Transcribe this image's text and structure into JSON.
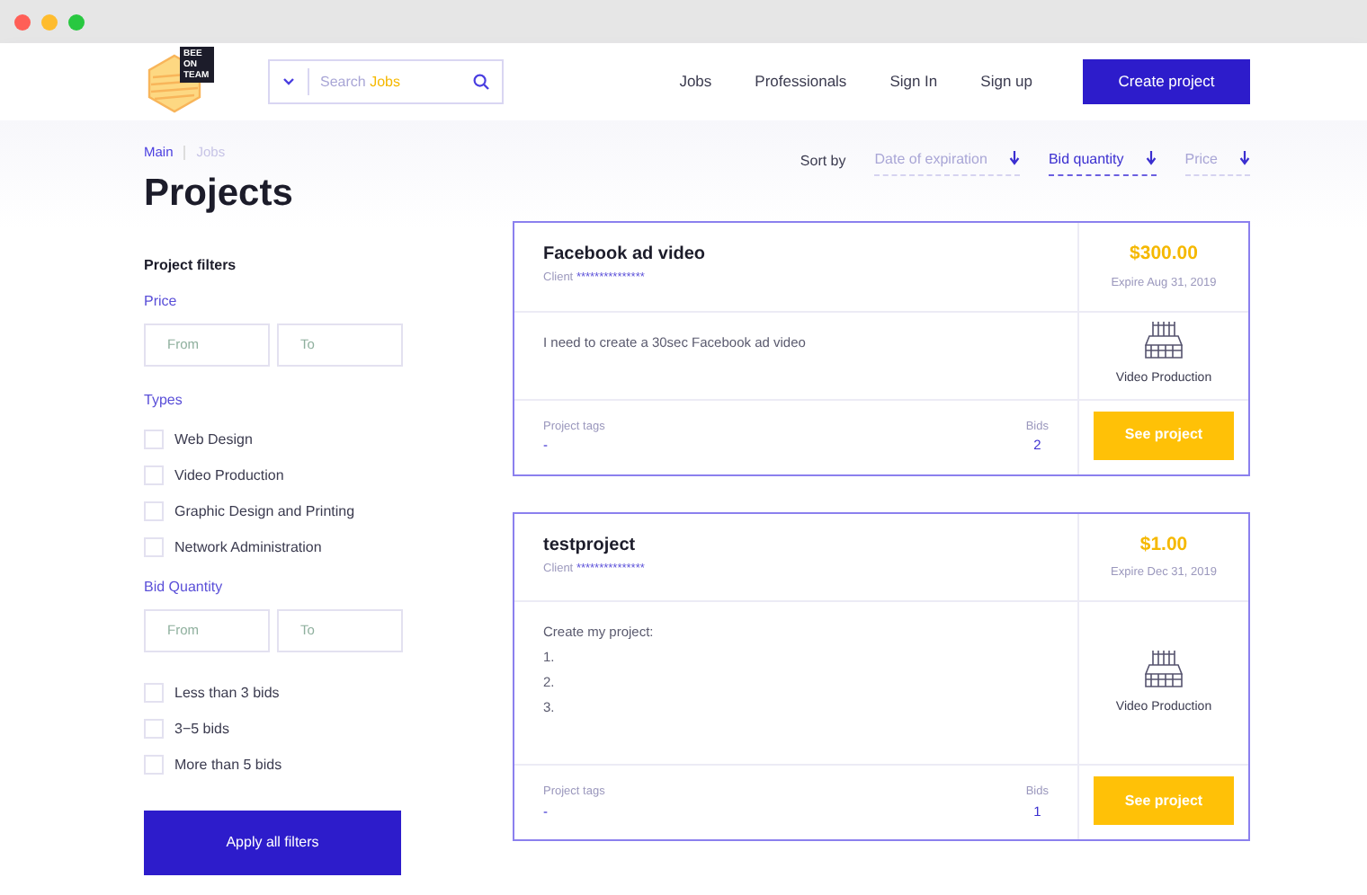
{
  "logo": {
    "text": "BEE ON TEAM"
  },
  "search": {
    "placeholder": "Search",
    "placeholder_accent": "Jobs"
  },
  "nav": [
    "Jobs",
    "Professionals",
    "Sign In",
    "Sign up"
  ],
  "create_button": "Create project",
  "breadcrumb": [
    {
      "label": "Main",
      "selected": false
    },
    {
      "label": "Jobs",
      "selected": true
    }
  ],
  "page_title": "Projects",
  "filters": {
    "title": "Project filters",
    "groups": [
      {
        "kind": "range",
        "label": "Price",
        "from_placeholder": "From",
        "to_placeholder": "To"
      },
      {
        "kind": "checks",
        "label": "Types",
        "options": [
          {
            "label": "Web Design",
            "checked": false
          },
          {
            "label": "Video Production",
            "checked": false
          },
          {
            "label": "Graphic Design and Printing",
            "checked": false
          },
          {
            "label": "Network Administration",
            "checked": false
          }
        ]
      },
      {
        "kind": "range",
        "label": "Bid Quantity",
        "from_placeholder": "From",
        "to_placeholder": "To"
      },
      {
        "kind": "checks",
        "options": [
          {
            "label": "Less than 3 bids",
            "checked": false
          },
          {
            "label": "3−5 bids",
            "checked": false
          },
          {
            "label": "More than 5 bids",
            "checked": false
          }
        ]
      }
    ],
    "apply_button": "Apply all filters"
  },
  "sort": {
    "label": "Sort by",
    "options": [
      {
        "label": "Date of expiration",
        "selected": false
      },
      {
        "label": "Bid quantity",
        "selected": true
      },
      {
        "label": "Price",
        "selected": false
      }
    ]
  },
  "projects": [
    {
      "title": "Facebook ad video",
      "client_label": "Client",
      "client": "***************",
      "description": [
        "I need to create a 30sec Facebook ad video"
      ],
      "price": "$300.00",
      "expire": "Expire Aug 31, 2019",
      "category": "Video Production",
      "tags_label": "Project tags",
      "tags": "-",
      "bids_label": "Bids",
      "bids": "2",
      "button": "See project"
    },
    {
      "title": "testproject",
      "client_label": "Client",
      "client": "***************",
      "description": [
        "Create my project:",
        "1.",
        "2.",
        "3."
      ],
      "price": "$1.00",
      "expire": "Expire Dec 31, 2019",
      "category": "Video Production",
      "tags_label": "Project tags",
      "tags": "-",
      "bids_label": "Bids",
      "bids": "1",
      "button": "See project"
    }
  ]
}
